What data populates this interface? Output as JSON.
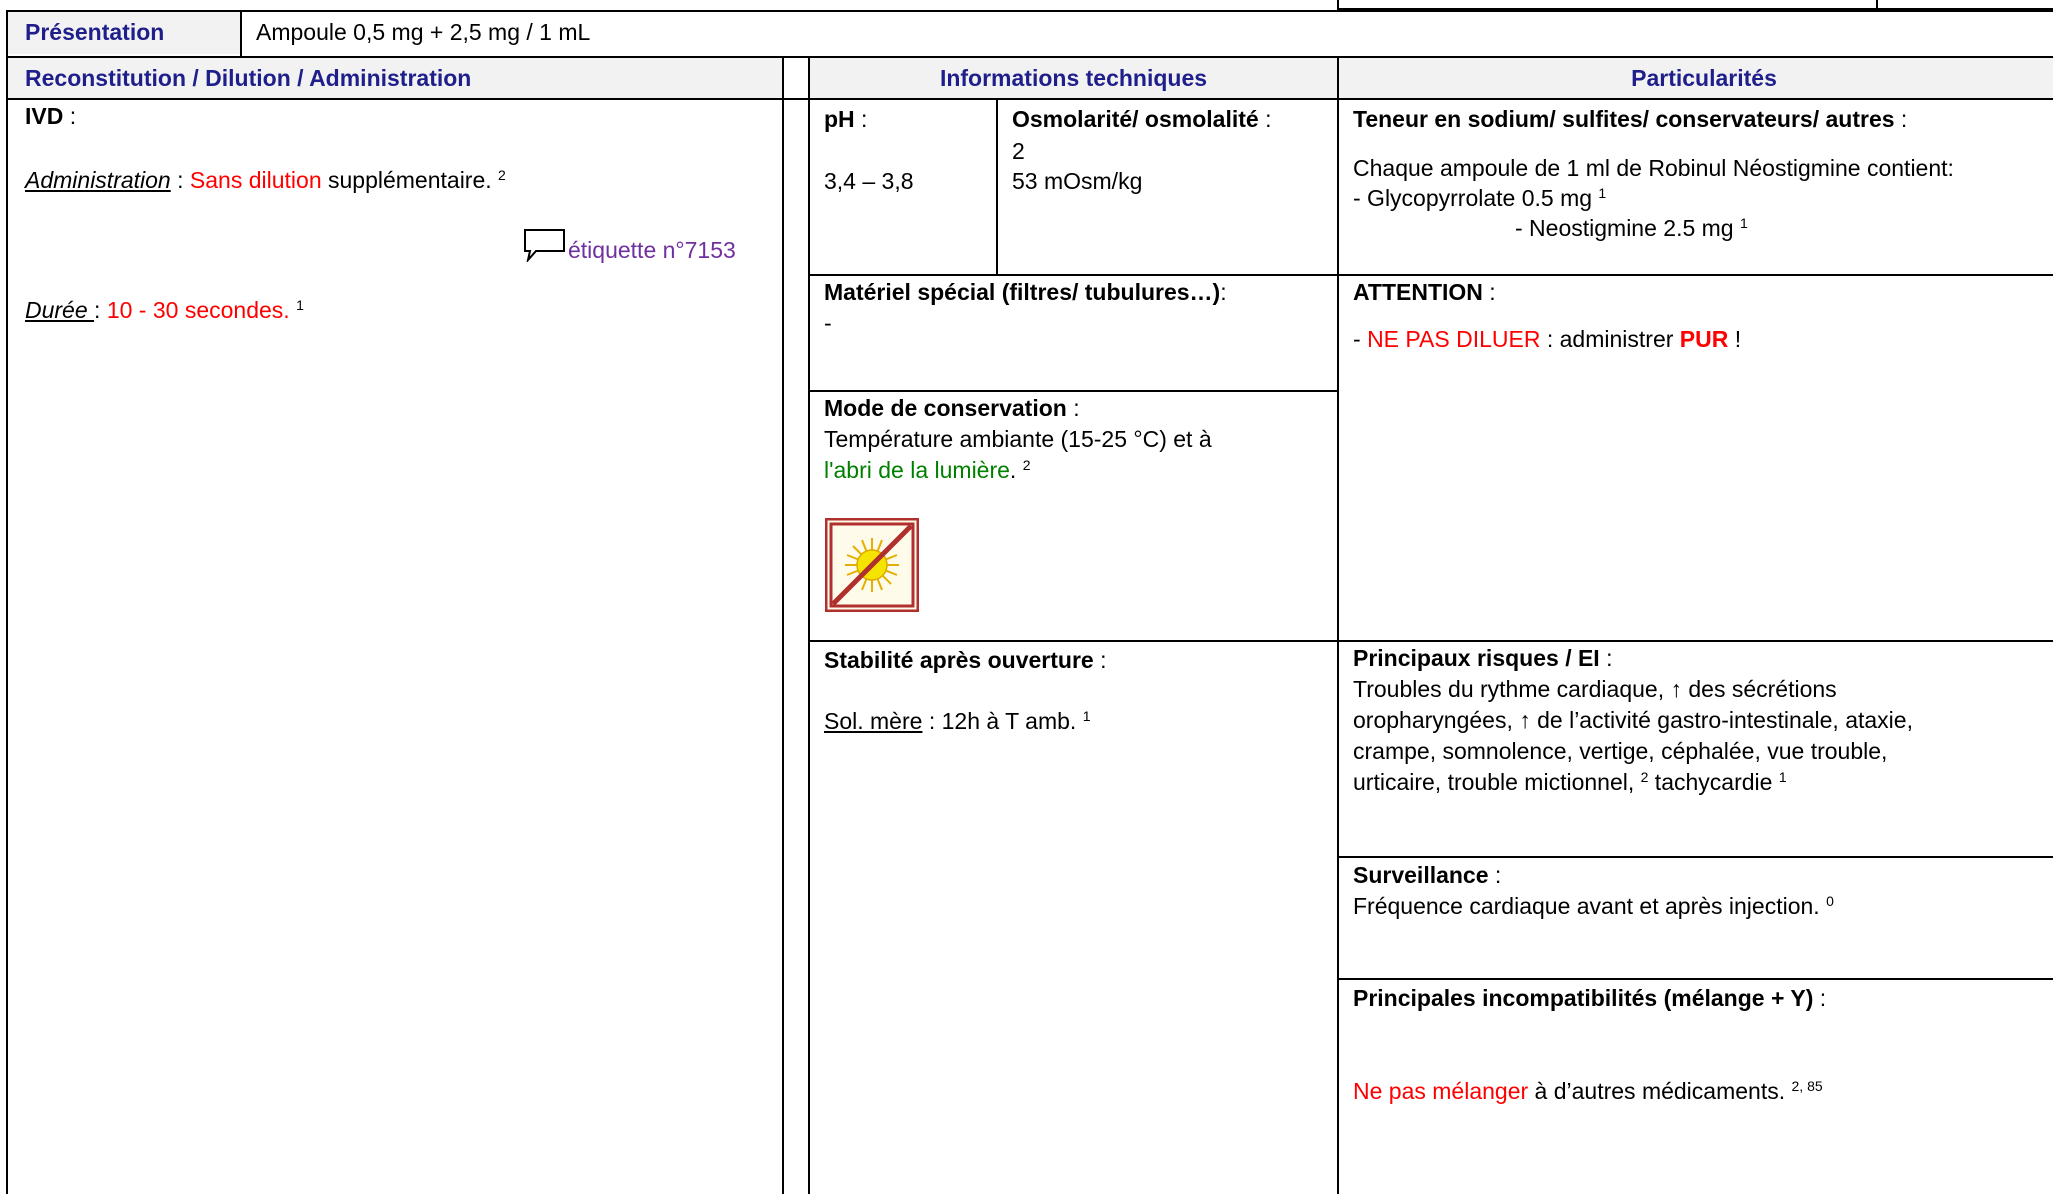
{
  "presentation": {
    "label": "Présentation",
    "value": "Ampoule 0,5 mg + 2,5 mg / 1 mL"
  },
  "headers": {
    "reconstitution": "Reconstitution / Dilution / Administration",
    "info": "Informations techniques",
    "particularites": "Particularités"
  },
  "ivd": {
    "title": "IVD",
    "colon": " :",
    "admin_label": "Administration",
    "admin_sep": " : ",
    "admin_red": "Sans dilution",
    "admin_rest": " supplémentaire. ",
    "admin_ref": "2",
    "etiquette": "étiquette n°7153",
    "duree_label": "Durée ",
    "duree_sep": ": ",
    "duree_value": "10 - 30 secondes. ",
    "duree_ref": "1"
  },
  "ph": {
    "label": "pH",
    "colon": " :",
    "value": "3,4 – 3,8"
  },
  "osmo": {
    "label": "Osmolarité/ osmolalité",
    "colon": " :",
    "value_line1": "2",
    "value_line2": "53 mOsm/kg"
  },
  "materiel": {
    "label": "Matériel spécial (filtres/ tubulures…)",
    "colon": ":",
    "value": "-"
  },
  "conservation": {
    "label": "Mode de conservation",
    "colon": " :",
    "line1": "Température ambiante (15-25 °C) et à",
    "line2_green": "l'abri de la lumière",
    "line2_rest": ". ",
    "ref": "2",
    "icon": "no-sunlight-icon"
  },
  "stabilite": {
    "label": "Stabilité après ouverture",
    "colon": " :",
    "sol_label": "Sol. mère",
    "sol_value": " : 12h à T amb. ",
    "ref": "1"
  },
  "teneur": {
    "label": "Teneur en sodium/ sulfites/ conservateurs/ autres",
    "colon": " :",
    "line1": "Chaque ampoule de 1 ml de Robinul Néostigmine contient:",
    "line2": "- Glycopyrrolate 0.5 mg ",
    "line2_ref": "1",
    "line3": "- Neostigmine 2.5 mg ",
    "line3_ref": "1"
  },
  "attention": {
    "label": "ATTENTION",
    "colon": " :",
    "dash": "- ",
    "red": "NE PAS DILUER",
    "mid": " : administrer ",
    "pur": "PUR",
    "end": " !"
  },
  "risques": {
    "label": "Principaux risques / EI",
    "colon": " :",
    "line1": "Troubles du rythme cardiaque, ↑ des sécrétions",
    "line2": "oropharyngées, ↑ de l’activité gastro-intestinale, ataxie,",
    "line3": "crampe, somnolence, vertige, céphalée, vue trouble,",
    "line4": "urticaire, trouble mictionnel, ",
    "ref1": "2",
    "line4_b": " tachycardie ",
    "ref2": "1"
  },
  "surveillance": {
    "label": "Surveillance",
    "colon": " :",
    "value": "Fréquence cardiaque avant et après injection. ",
    "ref": "0"
  },
  "incompat": {
    "label": "Principales incompatibilités (mélange + Y)",
    "colon": " :",
    "red": "Ne pas mélanger",
    "rest": " à d’autres médicaments. ",
    "ref": "2, 85"
  }
}
